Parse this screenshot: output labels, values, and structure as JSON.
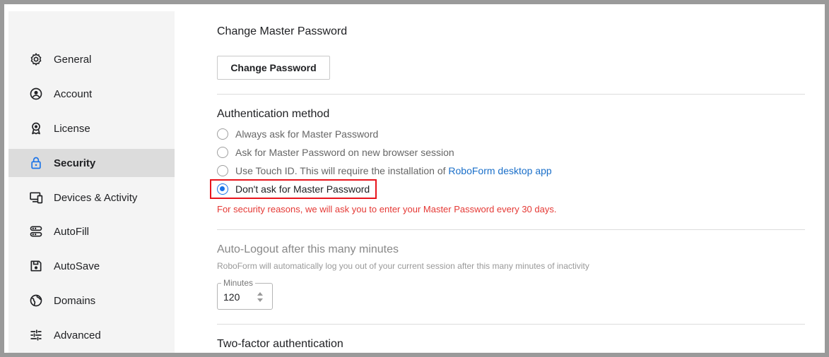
{
  "sidebar": {
    "items": [
      {
        "label": "General",
        "icon": "gear-icon"
      },
      {
        "label": "Account",
        "icon": "account-circle-icon"
      },
      {
        "label": "License",
        "icon": "license-badge-icon"
      },
      {
        "label": "Security",
        "icon": "lock-icon",
        "active": true
      },
      {
        "label": "Devices & Activity",
        "icon": "devices-icon"
      },
      {
        "label": "AutoFill",
        "icon": "autofill-icon"
      },
      {
        "label": "AutoSave",
        "icon": "save-icon"
      },
      {
        "label": "Domains",
        "icon": "globe-icon"
      },
      {
        "label": "Advanced",
        "icon": "sliders-icon"
      }
    ]
  },
  "main": {
    "change_password": {
      "title": "Change Master Password",
      "button_label": "Change Password"
    },
    "auth": {
      "title": "Authentication method",
      "options": [
        {
          "label": "Always ask for Master Password",
          "checked": false
        },
        {
          "label": "Ask for Master Password on new browser session",
          "checked": false
        },
        {
          "label": "Use Touch ID. This will require the installation of",
          "link": "RoboForm desktop app",
          "checked": false
        },
        {
          "label": "Don't ask for Master Password",
          "checked": true
        }
      ],
      "warning": "For security reasons, we will ask you to enter your Master Password every 30 days."
    },
    "auto_logout": {
      "title": "Auto-Logout after this many minutes",
      "description": "RoboForm will automatically log you out of your current session after this many minutes of inactivity",
      "field_label": "Minutes",
      "value": "120"
    },
    "two_factor": {
      "title": "Two-factor authentication"
    }
  },
  "colors": {
    "accent": "#1a73e8",
    "link": "#1a6fc9",
    "warning": "#e53935",
    "highlight": "#e8141c",
    "sidebar_bg": "#f4f4f4",
    "sidebar_active": "#dcdcdc"
  }
}
